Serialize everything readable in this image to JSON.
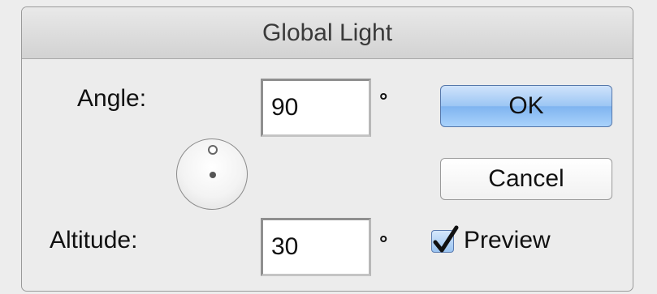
{
  "dialog": {
    "title": "Global Light",
    "angle": {
      "label": "Angle:",
      "value": "90",
      "unit": "°"
    },
    "altitude": {
      "label": "Altitude:",
      "value": "30",
      "unit": "°"
    },
    "buttons": {
      "ok": "OK",
      "cancel": "Cancel"
    },
    "preview": {
      "label": "Preview",
      "checked": true
    },
    "accent_color": "#8ebef4"
  }
}
